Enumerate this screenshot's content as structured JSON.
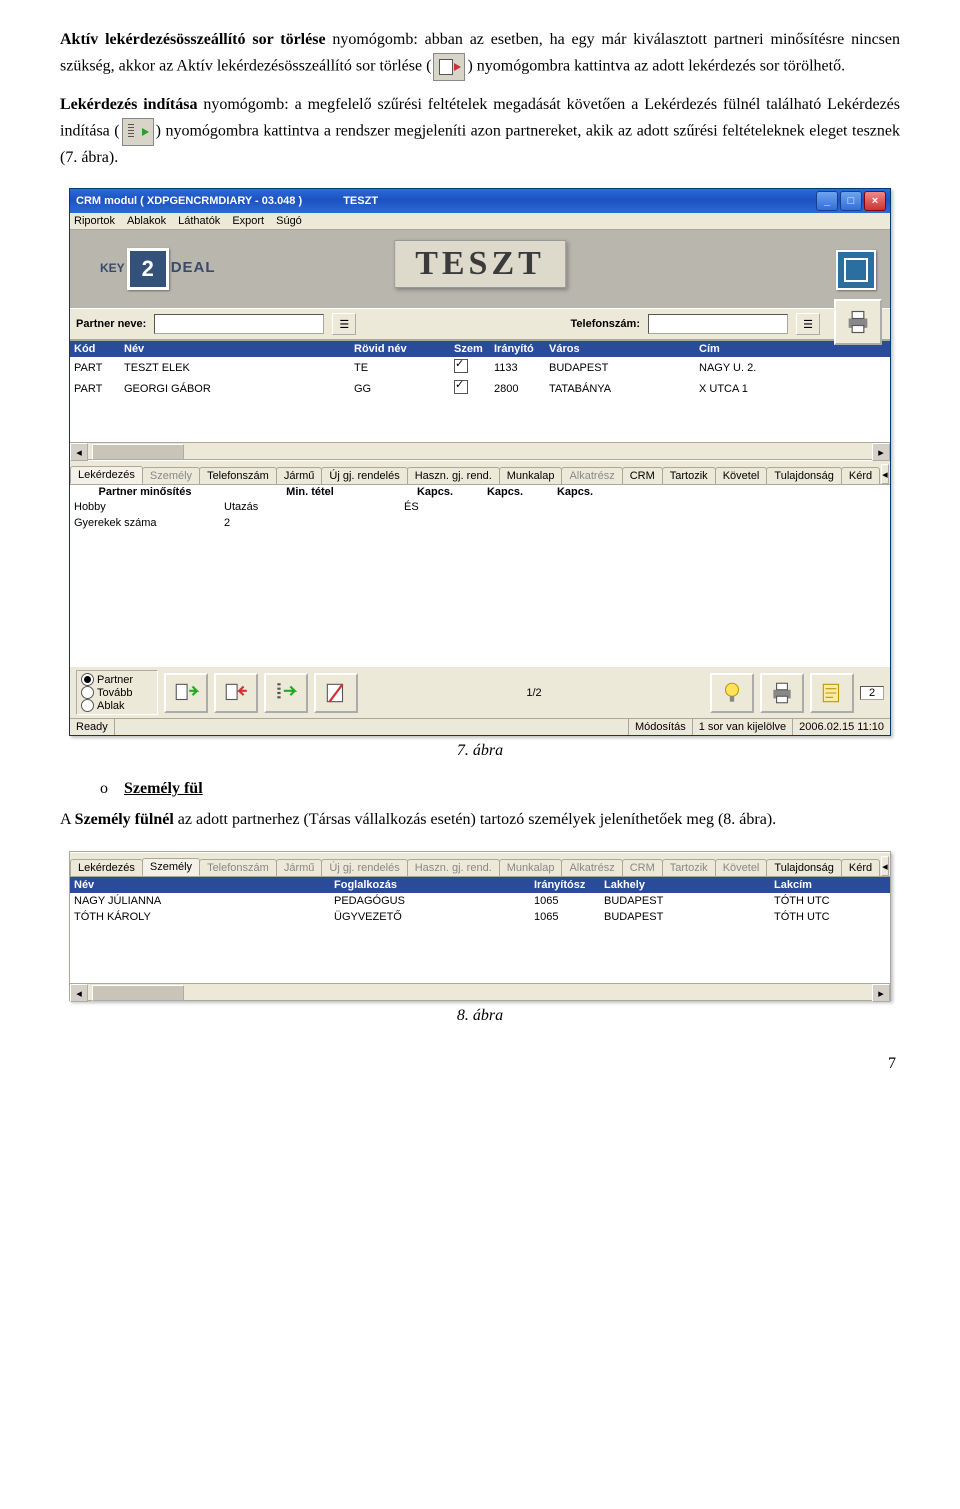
{
  "para1": {
    "b1": "Aktív lekérdezésösszeállító sor törlése",
    "t1": " nyomógomb: abban az esetben, ha egy már kiválasztott partneri minősítésre nincsen szükség, akkor az Aktív lekérdezésösszeállító sor törlése (",
    "t2": ") nyomógombra kattintva az adott lekérdezés sor törölhető."
  },
  "para2": {
    "b1": "Lekérdezés indítása",
    "t1": " nyomógomb: a megfelelő szűrési feltételek megadását követően a Lekérdezés fülnél található Lekérdezés indítása (",
    "t2": ") nyomógombra kattintva a rendszer megjeleníti azon partnereket, akik az adott szűrési feltételeknek eleget tesznek (7. ábra)."
  },
  "caption7": "7. ábra",
  "caption8": "8. ábra",
  "bullet_o": "o",
  "bullet_label": "Személy fül",
  "para3": {
    "t1": "A ",
    "b1": "Személy fülnél",
    "t2": " az adott partnerhez (Társas vállalkozás esetén) tartozó személyek jeleníthetőek meg (8. ábra)."
  },
  "page_number": "7",
  "fig7": {
    "title_left": "CRM modul ( XDPGENCRMDIARY - 03.048 )",
    "title_right_test": "TESZT",
    "menu": [
      "Riportok",
      "Ablakok",
      "Láthatók",
      "Export",
      "Súgó"
    ],
    "brand": "DEAL",
    "brand_key": "KEY",
    "banner_teszt": "TESZT",
    "filter_partner_label": "Partner neve:",
    "filter_phone_label": "Telefonszám:",
    "grid_headers": [
      "Kód",
      "Név",
      "Rövid név",
      "Szem",
      "Irányító",
      "Város",
      "Cím"
    ],
    "grid_rows": [
      {
        "kod": "PART",
        "nev": "TESZT ELEK",
        "rov": "TE",
        "szem": true,
        "ir": "1133",
        "varos": "BUDAPEST",
        "cim": "NAGY U. 2."
      },
      {
        "kod": "PART",
        "nev": "GEORGI GÁBOR",
        "rov": "GG",
        "szem": true,
        "ir": "2800",
        "varos": "TATABÁNYA",
        "cim": "X UTCA 1"
      }
    ],
    "tabs": [
      "Lekérdezés",
      "Személy",
      "Telefonszám",
      "Jármű",
      "Új gj. rendelés",
      "Haszn. gj. rend.",
      "Munkalap",
      "Alkatrész",
      "CRM",
      "Tartozik",
      "Követel",
      "Tulajdonság",
      "Kérd"
    ],
    "active_tab_index": 0,
    "disabled_tabs": [
      "Személy",
      "Alkatrész"
    ],
    "sub_headers": [
      "Partner minősítés",
      "Min. tétel",
      "Kapcs.",
      "Kapcs.",
      "Kapcs."
    ],
    "sub_rows": [
      {
        "m": "Hobby",
        "t": "Utazás",
        "k": "ÉS"
      },
      {
        "m": "Gyerekek száma",
        "t": "2",
        "k": ""
      }
    ],
    "radios": [
      "Partner",
      "Tovább",
      "Ablak"
    ],
    "radio_selected": 0,
    "page_indicator": "1/2",
    "count_box": "2",
    "status": {
      "ready": "Ready",
      "mode": "Módosítás",
      "sel": "1 sor van kijelölve",
      "time": "2006.02.15 11:10"
    }
  },
  "fig8": {
    "tabs": [
      "Lekérdezés",
      "Személy",
      "Telefonszám",
      "Jármű",
      "Új gj. rendelés",
      "Haszn. gj. rend.",
      "Munkalap",
      "Alkatrész",
      "CRM",
      "Tartozik",
      "Követel",
      "Tulajdonság",
      "Kérd"
    ],
    "active_tab_index": 1,
    "disabled_tabs": [
      "Telefonszám",
      "Jármű",
      "Új gj. rendelés",
      "Haszn. gj. rend.",
      "Munkalap",
      "Alkatrész",
      "CRM",
      "Tartozik",
      "Követel"
    ],
    "headers": [
      "Név",
      "Foglalkozás",
      "Irányítósz",
      "Lakhely",
      "Lakcím"
    ],
    "rows": [
      {
        "nev": "NAGY JÚLIANNA",
        "fog": "PEDAGÓGUS",
        "ir": "1065",
        "lak": "BUDAPEST",
        "cim": "TÓTH UTC"
      },
      {
        "nev": "TÓTH KÁROLY",
        "fog": "ÜGYVEZETŐ",
        "ir": "1065",
        "lak": "BUDAPEST",
        "cim": "TÓTH UTC"
      }
    ]
  }
}
